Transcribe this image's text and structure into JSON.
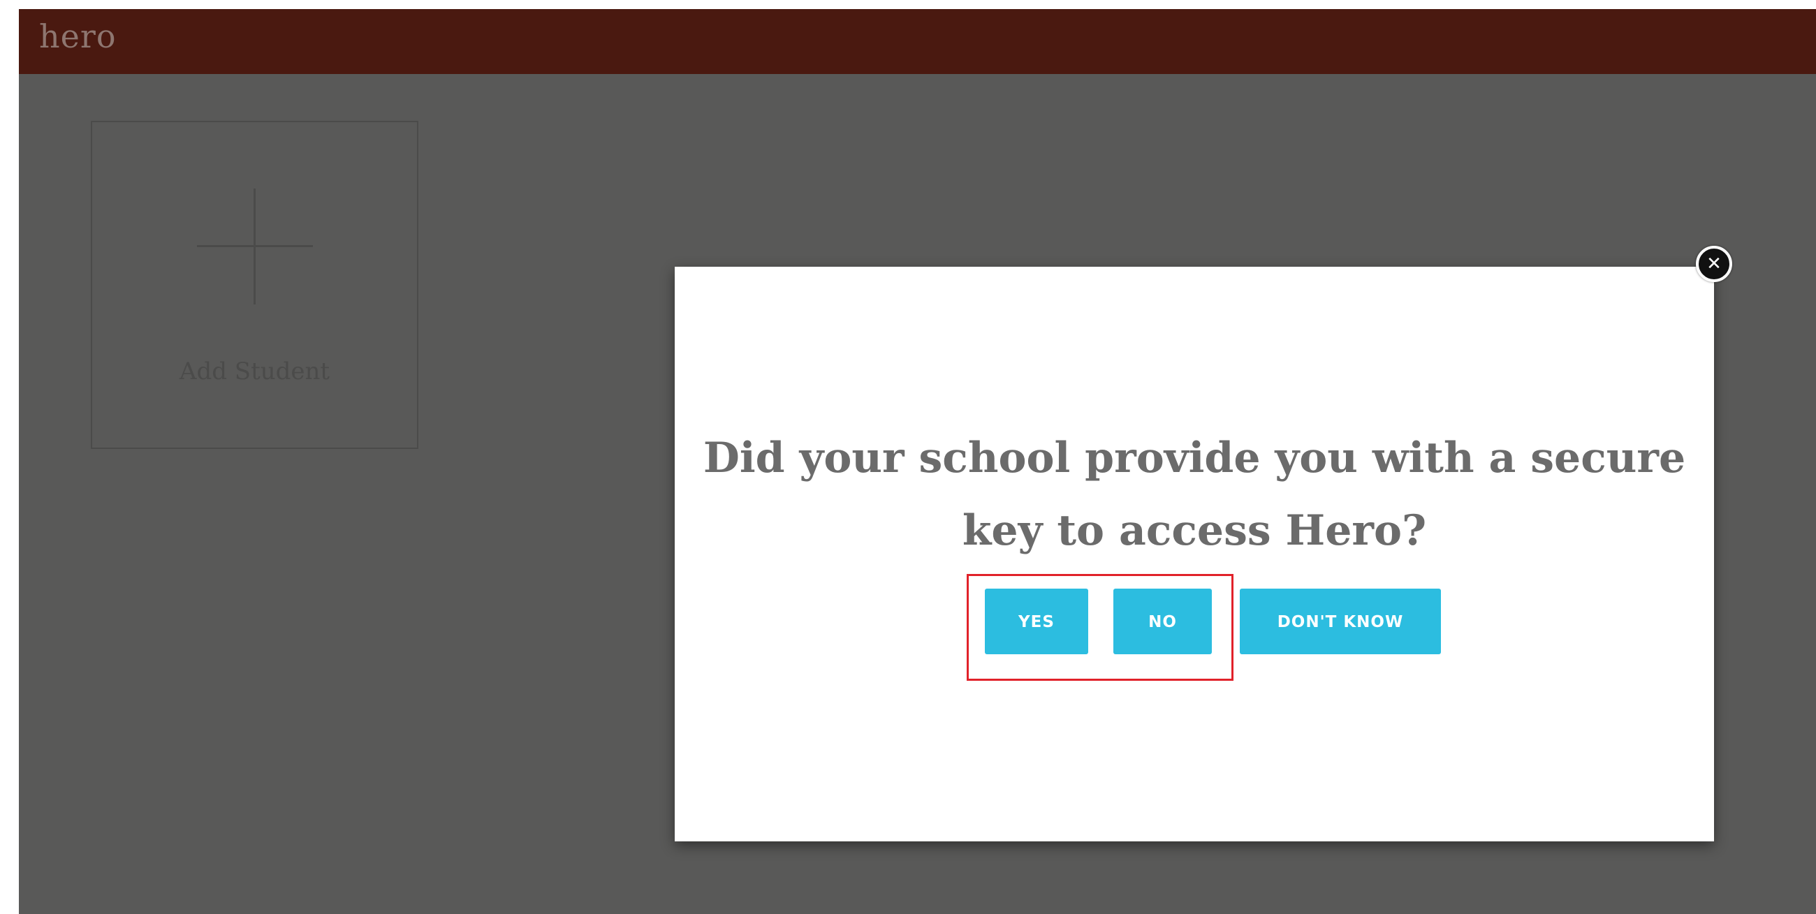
{
  "app": {
    "logo_text": "hero"
  },
  "add_student": {
    "label": "Add Student",
    "icon": "plus-icon"
  },
  "modal": {
    "question": "Did your school provide you with a secure key to access Hero?",
    "close_icon": "close-icon",
    "close_glyph": "✕",
    "buttons": {
      "yes": "YES",
      "no": "NO",
      "dont_know": "DON'T KNOW"
    }
  },
  "colors": {
    "topbar": "#4a1910",
    "background": "#595958",
    "button": "#2cbde0",
    "highlight": "#e1222a"
  }
}
